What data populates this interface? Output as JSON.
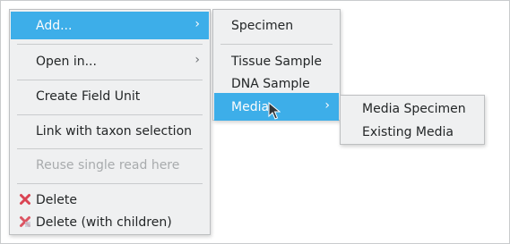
{
  "menu": {
    "items": [
      {
        "label": "Add...",
        "highlighted": true,
        "submenu": true
      },
      {
        "label": "Open in...",
        "submenu": true
      },
      {
        "label": "Create Field Unit"
      },
      {
        "label": "Link with taxon selection"
      },
      {
        "label": "Reuse single read here",
        "disabled": true
      },
      {
        "label": "Delete",
        "icon": "red-x-icon"
      },
      {
        "label": "Delete (with children)",
        "icon": "red-x-faded-icon"
      }
    ]
  },
  "submenu_add": {
    "items": [
      {
        "label": "Specimen"
      },
      {
        "label": "Tissue Sample"
      },
      {
        "label": "DNA Sample"
      },
      {
        "label": "Media",
        "highlighted": true,
        "submenu": true
      }
    ]
  },
  "submenu_media": {
    "items": [
      {
        "label": "Media Specimen"
      },
      {
        "label": "Existing Media"
      }
    ]
  },
  "arrow_glyph": "›",
  "colors": {
    "highlight": "#3daee9",
    "delete_icon": "#da4453",
    "menu_bg": "#eff0f1",
    "disabled_text": "#a8abad"
  }
}
